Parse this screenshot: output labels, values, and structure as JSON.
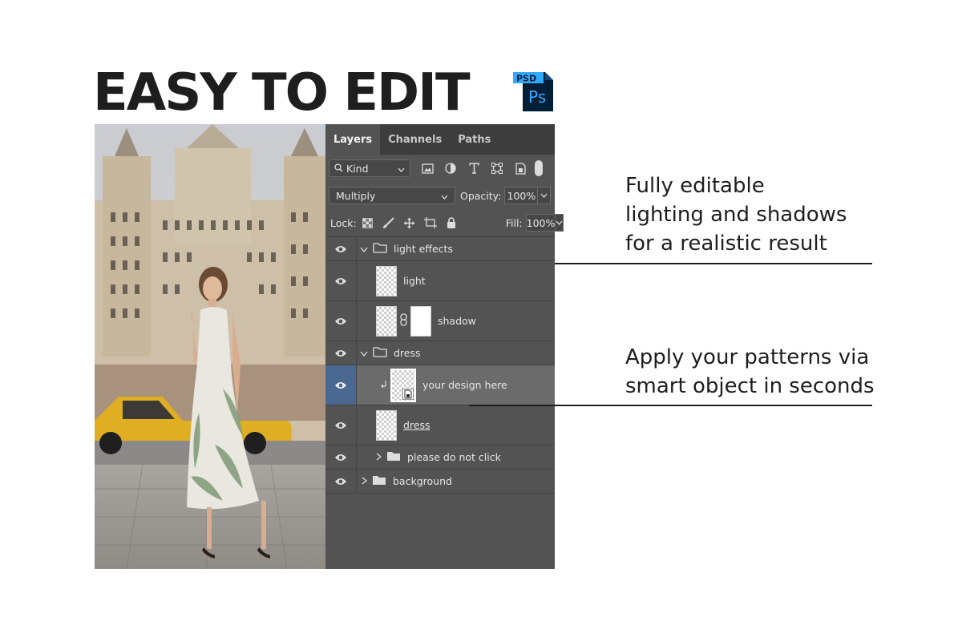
{
  "headline": "EASY TO EDIT",
  "psd_badge": {
    "top_label": "PSD",
    "app_label": "Ps"
  },
  "panel": {
    "tabs": [
      "Layers",
      "Channels",
      "Paths"
    ],
    "filter": {
      "kind_label": "Kind"
    },
    "blend_mode": "Multiply",
    "opacity_label": "Opacity:",
    "opacity_value": "100%",
    "lock_label": "Lock:",
    "fill_label": "Fill:",
    "fill_value": "100%",
    "layers": [
      {
        "name": "light effects",
        "type": "group",
        "expanded": true
      },
      {
        "name": "light",
        "type": "layer"
      },
      {
        "name": "shadow",
        "type": "layer-with-mask"
      },
      {
        "name": "dress",
        "type": "group",
        "expanded": true
      },
      {
        "name": "your design here",
        "type": "smart-object",
        "selected": true
      },
      {
        "name": "dress",
        "type": "layer"
      },
      {
        "name": "please do not click",
        "type": "group",
        "expanded": false
      },
      {
        "name": "background",
        "type": "group",
        "expanded": false
      }
    ]
  },
  "callouts": [
    {
      "lines": [
        "Fully editable",
        "lighting and shadows",
        "for a realistic result"
      ]
    },
    {
      "lines": [
        "Apply your patterns via",
        "smart object in seconds"
      ]
    }
  ],
  "colors": {
    "panel_bg": "#535353",
    "tab_bar": "#3d3d3d",
    "selected_eye": "#4a6891",
    "ps_blue": "#31a8ff",
    "ps_dark": "#001e36"
  },
  "icons": [
    "search-icon",
    "chevron-down-icon",
    "image-filter-icon",
    "adjustment-filter-icon",
    "type-filter-icon",
    "shape-filter-icon",
    "smart-object-filter-icon",
    "eye-icon",
    "folder-icon",
    "chain-link-icon",
    "lock-icon",
    "move-icon",
    "brush-icon",
    "transparency-lock-icon",
    "artboard-lock-icon"
  ]
}
